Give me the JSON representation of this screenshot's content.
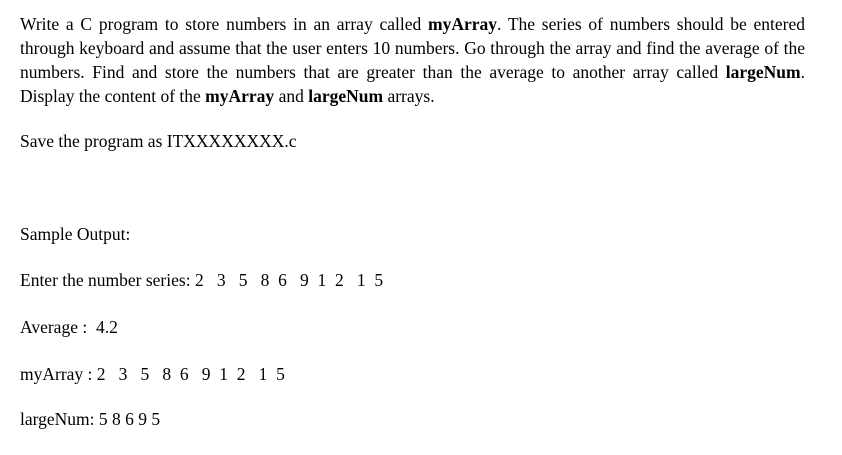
{
  "task": {
    "seg1": "Write a C program to store numbers in an array called ",
    "seg2": "myArray",
    "seg3": ". The series of numbers should be entered through keyboard and assume that the user enters 10 numbers. Go through the array and find the average of the numbers. Find and store the numbers that are greater than the average to another array called ",
    "seg4": "largeNum",
    "seg5": ". Display the content of the ",
    "seg6": "myArray",
    "seg7": "  and ",
    "seg8": "largeNum",
    "seg9": " arrays."
  },
  "save_line": "Save the program as ITXXXXXXXX.c",
  "sample": {
    "heading": "Sample Output:",
    "input_line": "Enter the number series: 2   3   5   8  6   9  1  2   1  5",
    "average_line": "Average :  4.2",
    "myarray_line": "myArray : 2   3   5   8  6   9  1  2   1  5",
    "largenum_line": "largeNum: 5 8 6 9 5"
  }
}
